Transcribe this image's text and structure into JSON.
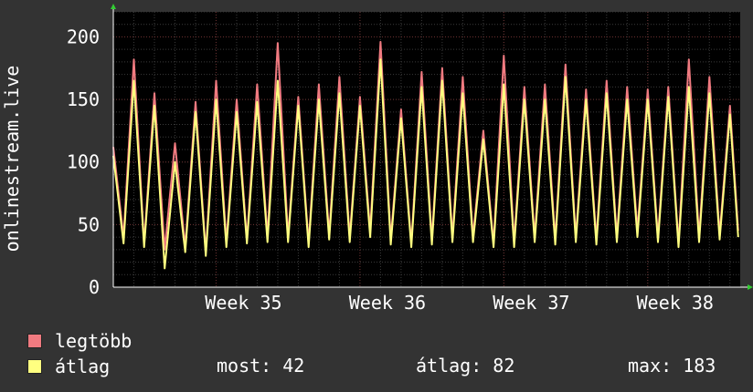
{
  "chart_data": {
    "type": "line",
    "ylabel": "onlinestream.live",
    "ylim": [
      0,
      220
    ],
    "yticks": [
      0,
      50,
      100,
      150,
      200
    ],
    "x_tick_labels": [
      "Week 35",
      "Week 36",
      "Week 37",
      "Week 38"
    ],
    "x_tick_positions": [
      5,
      12,
      19,
      26
    ],
    "x_range": [
      0,
      30.5
    ],
    "grid": true,
    "legend_position": "bottom-left",
    "series": [
      {
        "name": "legtöbb",
        "color": "#f07a80",
        "x": [
          0,
          0.5,
          1,
          1.5,
          2,
          2.5,
          3,
          3.5,
          4,
          4.5,
          5,
          5.5,
          6,
          6.5,
          7,
          7.5,
          8,
          8.5,
          9,
          9.5,
          10,
          10.5,
          11,
          11.5,
          12,
          12.5,
          13,
          13.5,
          14,
          14.5,
          15,
          15.5,
          16,
          16.5,
          17,
          17.5,
          18,
          18.5,
          19,
          19.5,
          20,
          20.5,
          21,
          21.5,
          22,
          22.5,
          23,
          23.5,
          24,
          24.5,
          25,
          25.5,
          26,
          26.5,
          27,
          27.5,
          28,
          28.5,
          29,
          29.5,
          30,
          30.4
        ],
        "values": [
          112,
          40,
          182,
          35,
          155,
          30,
          115,
          32,
          148,
          28,
          165,
          36,
          150,
          38,
          162,
          40,
          195,
          40,
          152,
          35,
          162,
          42,
          168,
          40,
          152,
          45,
          196,
          38,
          142,
          35,
          172,
          38,
          175,
          40,
          168,
          40,
          125,
          35,
          185,
          36,
          160,
          40,
          162,
          38,
          178,
          40,
          158,
          38,
          165,
          40,
          160,
          45,
          158,
          40,
          160,
          35,
          182,
          40,
          168,
          42,
          145,
          45
        ]
      },
      {
        "name": "átlag",
        "color": "#ffff80",
        "x": [
          0,
          0.5,
          1,
          1.5,
          2,
          2.5,
          3,
          3.5,
          4,
          4.5,
          5,
          5.5,
          6,
          6.5,
          7,
          7.5,
          8,
          8.5,
          9,
          9.5,
          10,
          10.5,
          11,
          11.5,
          12,
          12.5,
          13,
          13.5,
          14,
          14.5,
          15,
          15.5,
          16,
          16.5,
          17,
          17.5,
          18,
          18.5,
          19,
          19.5,
          20,
          20.5,
          21,
          21.5,
          22,
          22.5,
          23,
          23.5,
          24,
          24.5,
          25,
          25.5,
          26,
          26.5,
          27,
          27.5,
          28,
          28.5,
          29,
          29.5,
          30,
          30.4
        ],
        "values": [
          105,
          35,
          165,
          32,
          145,
          15,
          100,
          28,
          140,
          25,
          150,
          32,
          140,
          35,
          148,
          36,
          165,
          36,
          145,
          32,
          150,
          38,
          155,
          36,
          145,
          40,
          182,
          34,
          135,
          32,
          160,
          34,
          165,
          36,
          155,
          36,
          118,
          32,
          162,
          32,
          150,
          36,
          150,
          34,
          168,
          36,
          150,
          34,
          155,
          36,
          150,
          40,
          150,
          36,
          152,
          32,
          160,
          36,
          155,
          38,
          138,
          40
        ]
      }
    ],
    "stats": {
      "most_label": "most:",
      "most_value": "42",
      "atlag_label": "átlag:",
      "atlag_value": "82",
      "max_label": "max:",
      "max_value": "183"
    }
  }
}
